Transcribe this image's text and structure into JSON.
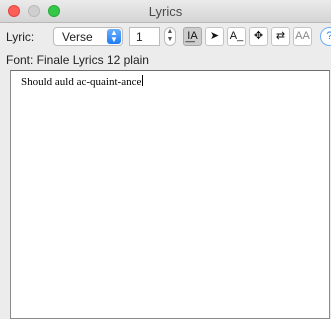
{
  "window": {
    "title": "Lyrics"
  },
  "toolbar": {
    "lyric_label": "Lyric:",
    "lyric_type": "Verse",
    "verse_number": "1",
    "tools": [
      {
        "name": "click-assignment-tool",
        "glyph": "I͟A",
        "active": true
      },
      {
        "name": "selection-arrow-tool",
        "glyph": "➤",
        "active": false
      },
      {
        "name": "adjust-baseline-tool",
        "glyph": "A_",
        "active": false
      },
      {
        "name": "move-syllable-tool",
        "glyph": "✥",
        "active": false
      },
      {
        "name": "shift-lyrics-tool",
        "glyph": "⇄",
        "active": false
      },
      {
        "name": "edit-text-tool",
        "glyph": "AA",
        "active": false
      }
    ],
    "help_glyph": "?"
  },
  "font_info": "Font: Finale Lyrics 12 plain",
  "editor": {
    "text": "Should auld ac-quaint-ance"
  }
}
